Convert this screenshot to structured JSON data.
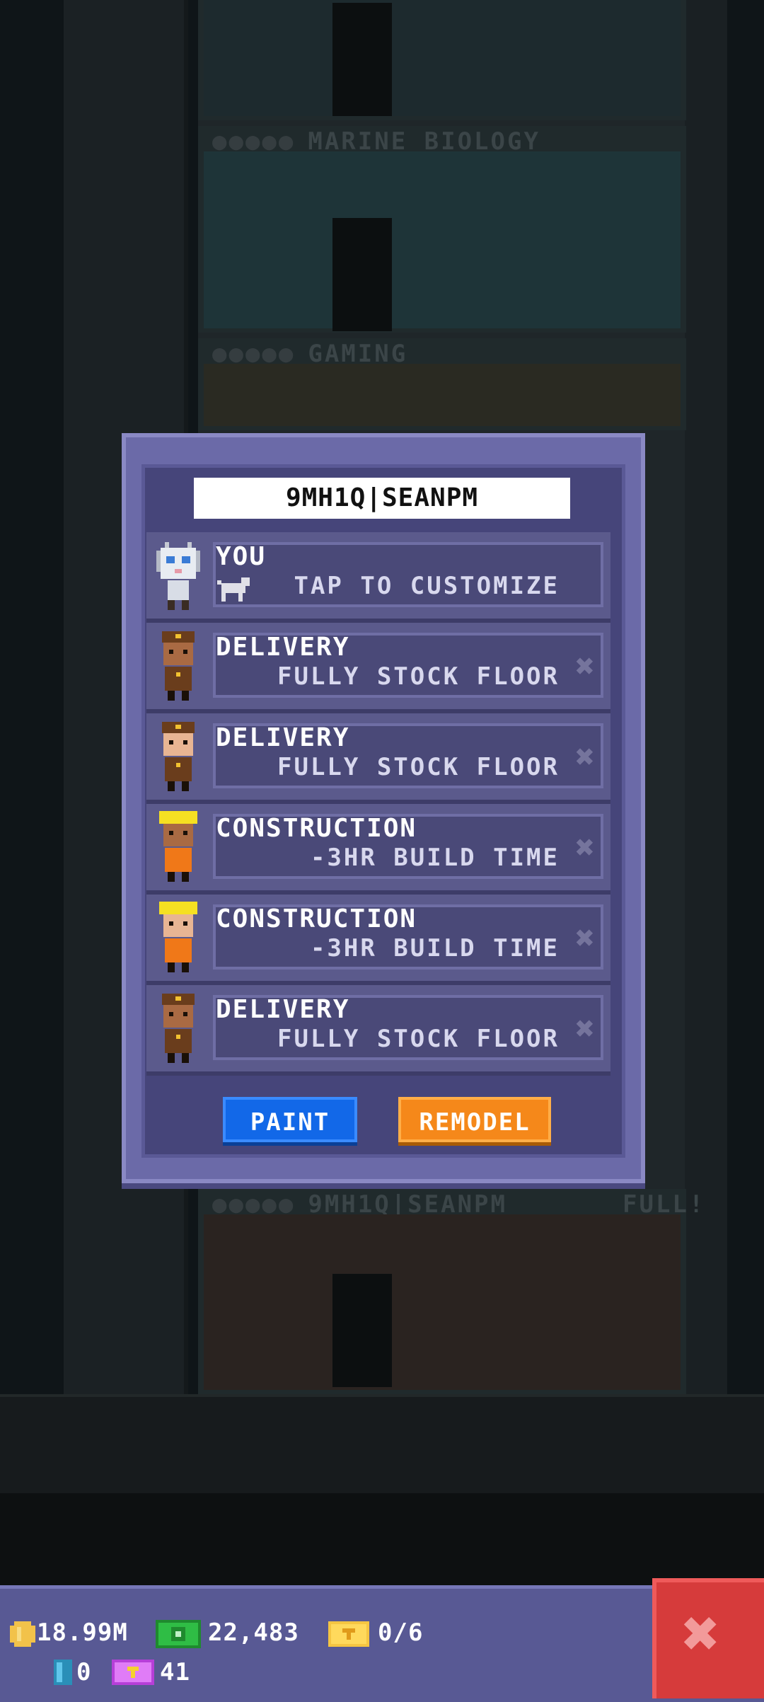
{
  "background": {
    "floor_labels": [
      "MARINE BIOLOGY",
      "GAMING",
      "9MH1Q|SEANPM"
    ],
    "floor_status": "FULL!"
  },
  "dialog": {
    "tower_name": "9MH1Q|SEANPM",
    "rows": [
      {
        "title": "YOU",
        "subtitle": "TAP TO CUSTOMIZE",
        "avatar": "robot-avatar-icon",
        "removable": false
      },
      {
        "title": "DELIVERY",
        "subtitle": "FULLY STOCK FLOOR",
        "avatar": "delivery-worker-icon",
        "removable": true
      },
      {
        "title": "DELIVERY",
        "subtitle": "FULLY STOCK FLOOR",
        "avatar": "delivery-worker-icon",
        "removable": true
      },
      {
        "title": "CONSTRUCTION",
        "subtitle": "-3HR BUILD TIME",
        "avatar": "construction-worker-icon",
        "removable": true
      },
      {
        "title": "CONSTRUCTION",
        "subtitle": "-3HR BUILD TIME",
        "avatar": "construction-worker-icon",
        "removable": true
      },
      {
        "title": "DELIVERY",
        "subtitle": "FULLY STOCK FLOOR",
        "avatar": "delivery-worker-icon",
        "removable": true
      }
    ],
    "paint_label": "PAINT",
    "remodel_label": "REMODEL",
    "remove_glyph": "✖"
  },
  "hud": {
    "coins": "18.99M",
    "bux": "22,483",
    "tickets": "0/6",
    "keys": "0",
    "vip": "41"
  },
  "colors": {
    "dialog_bg": "#6b6aa8",
    "paint": "#1268e8",
    "remodel": "#f5881a",
    "close": "#d63b3b"
  }
}
